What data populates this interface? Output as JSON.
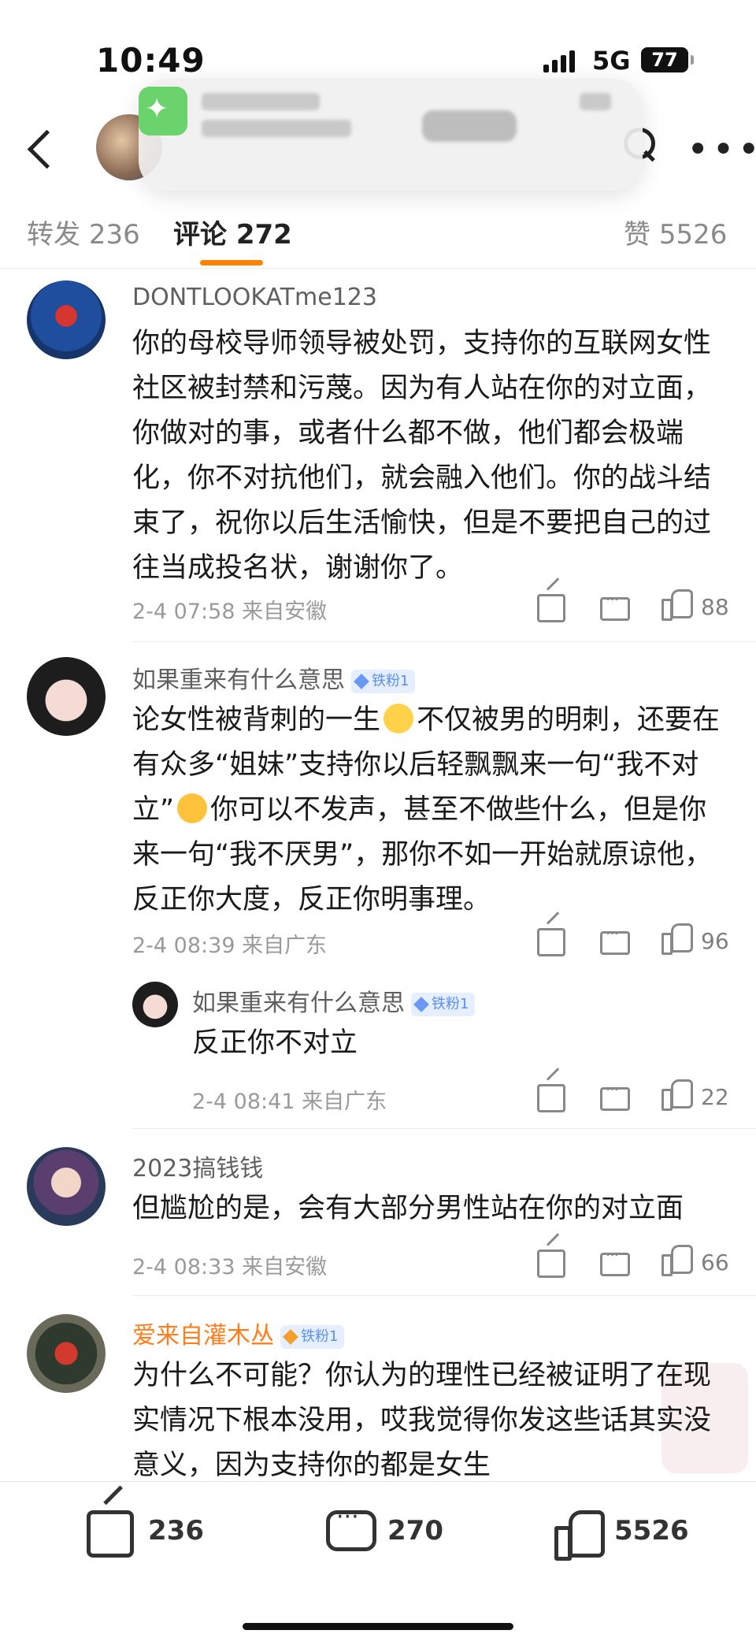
{
  "status": {
    "time": "10:49",
    "network": "5G",
    "battery": "77"
  },
  "tabs": [
    {
      "label": "转发",
      "count": "236"
    },
    {
      "label": "评论",
      "count": "272"
    },
    {
      "label": "赞",
      "count": "5526"
    }
  ],
  "comments": [
    {
      "user": "DONTLOOKATme123",
      "text": "你的母校导师领导被处罚，支持你的互联网女性社区被封禁和污蔑。因为有人站在你的对立面，你做对的事，或者什么都不做，他们都会极端化，你不对抗他们，就会融入他们。你的战斗结束了，祝你以后生活愉快，但是不要把自己的过往当成投名状，谢谢你了。",
      "time": "2-4 07:58 来自安徽",
      "likes": "88"
    },
    {
      "user": "如果重来有什么意思",
      "badge": "铁粉1",
      "text_a": "论女性被背刺的一生",
      "text_b": "不仅被男的明刺，还要在有众多“姐妹”支持你以后轻飘飘来一句“我不对立”",
      "text_c": "你可以不发声，甚至不做些什么，但是你来一句“我不厌男”，那你不如一开始就原谅他，反正你大度，反正你明事理。",
      "time": "2-4 08:39 来自广东",
      "likes": "96",
      "reply": {
        "user": "如果重来有什么意思",
        "badge": "铁粉1",
        "text": "反正你不对立",
        "time": "2-4 08:41 来自广东",
        "likes": "22"
      }
    },
    {
      "user": "2023搞钱钱",
      "text": "但尴尬的是，会有大部分男性站在你的对立面",
      "time": "2-4 08:33 来自安徽",
      "likes": "66"
    },
    {
      "user": "爱来自灌木丛",
      "badge": "铁粉1",
      "text": "为什么不可能？你认为的理性已经被证明了在现实情况下根本没用，哎我觉得你发这些话其实没意义，因为支持你的都是女生"
    }
  ],
  "bottom": {
    "reposts": "236",
    "comments": "270",
    "likes": "5526"
  },
  "colors": {
    "accent": "#ff8200",
    "badge": "#5b8ff0",
    "vip_name": "#ff7d1a"
  }
}
